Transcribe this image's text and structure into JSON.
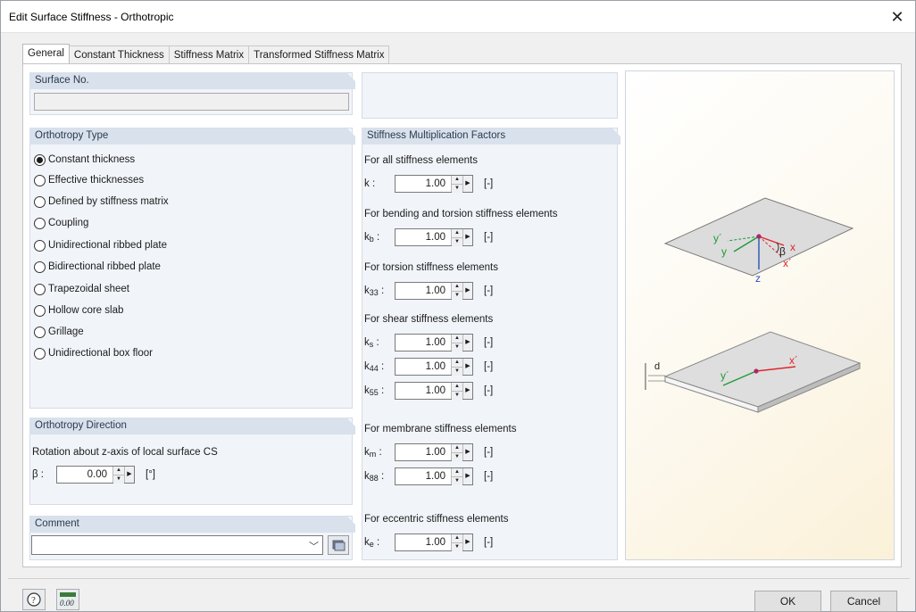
{
  "window": {
    "title": "Edit Surface Stiffness - Orthotropic",
    "close_glyph": "✕"
  },
  "tabs": [
    {
      "label": "General",
      "active": true
    },
    {
      "label": "Constant Thickness",
      "active": false
    },
    {
      "label": "Stiffness Matrix",
      "active": false
    },
    {
      "label": "Transformed Stiffness Matrix",
      "active": false
    }
  ],
  "surface_no": {
    "header": "Surface No.",
    "value": ""
  },
  "orthotropy_type": {
    "header": "Orthotropy Type",
    "options": [
      "Constant thickness",
      "Effective thicknesses",
      "Defined by stiffness matrix",
      "Coupling",
      "Unidirectional ribbed plate",
      "Bidirectional ribbed plate",
      "Trapezoidal sheet",
      "Hollow core slab",
      "Grillage",
      "Unidirectional box floor"
    ],
    "selected": "Constant thickness"
  },
  "orthotropy_direction": {
    "header": "Orthotropy Direction",
    "label": "Rotation about z-axis of local surface CS",
    "symbol": "β :",
    "value": "0.00",
    "unit": "[°]"
  },
  "comment": {
    "header": "Comment",
    "value": ""
  },
  "factors": {
    "header": "Stiffness Multiplication Factors",
    "sections": [
      {
        "title": "For all stiffness elements"
      },
      {
        "title": "For bending and torsion stiffness elements"
      },
      {
        "title": "For torsion stiffness elements"
      },
      {
        "title": "For shear stiffness elements"
      },
      {
        "title": "For membrane stiffness elements"
      },
      {
        "title": "For eccentric stiffness elements"
      }
    ],
    "rows": [
      {
        "sym": "k",
        "sub": "",
        "value": "1.00",
        "unit": "[-]"
      },
      {
        "sym": "k",
        "sub": "b",
        "value": "1.00",
        "unit": "[-]"
      },
      {
        "sym": "k",
        "sub": "33",
        "value": "1.00",
        "unit": "[-]"
      },
      {
        "sym": "k",
        "sub": "s",
        "value": "1.00",
        "unit": "[-]"
      },
      {
        "sym": "k",
        "sub": "44",
        "value": "1.00",
        "unit": "[-]"
      },
      {
        "sym": "k",
        "sub": "55",
        "value": "1.00",
        "unit": "[-]"
      },
      {
        "sym": "k",
        "sub": "m",
        "value": "1.00",
        "unit": "[-]"
      },
      {
        "sym": "k",
        "sub": "88",
        "value": "1.00",
        "unit": "[-]"
      },
      {
        "sym": "k",
        "sub": "e",
        "value": "1.00",
        "unit": "[-]"
      }
    ]
  },
  "diagram": {
    "labels": {
      "y_prime": "y´",
      "y": "y",
      "x": "x",
      "x_prime": "x´",
      "beta": "β",
      "z": "z",
      "d": "d",
      "y_prime_2": "y´",
      "x_prime_2": "x´"
    },
    "colors": {
      "red": "#e0262b",
      "green": "#1f9a3a",
      "blue": "#2d4fb8",
      "point": "#b0256b"
    }
  },
  "footer": {
    "ok_label": "OK",
    "cancel_label": "Cancel",
    "help_icon": "help-icon",
    "units_icon": "units-icon",
    "units_text": "0.00"
  }
}
